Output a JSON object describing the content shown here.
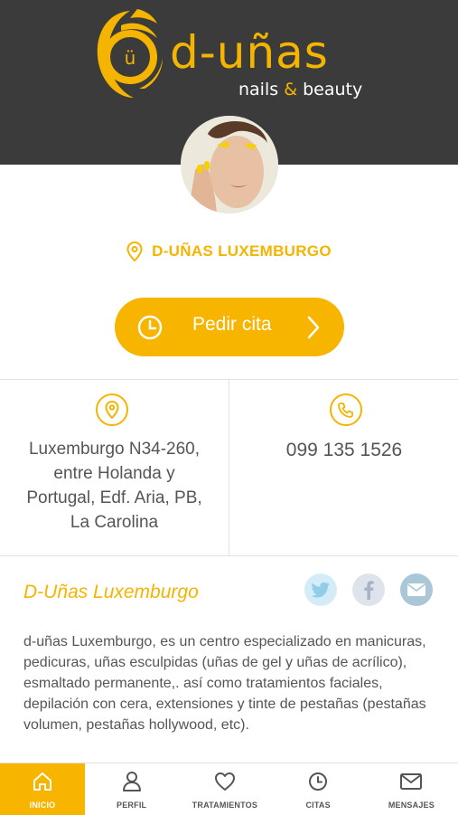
{
  "brand": {
    "name": "d-uñas",
    "tagline_left": "nails",
    "tagline_amp": "&",
    "tagline_right": "beauty",
    "logo_letter": "ü"
  },
  "colors": {
    "accent": "#f4b400",
    "header_bg": "#3b3b3b",
    "text": "#555555"
  },
  "location": {
    "name": "D-UÑAS LUXEMBURGO",
    "icon": "location-pin-icon"
  },
  "cta": {
    "label": "Pedir cita",
    "icon": "clock-icon"
  },
  "info": {
    "address_lines": [
      "Luxemburgo N34-260,",
      "entre Holanda y",
      "Portugal, Edf. Aria, PB,",
      "La Carolina"
    ],
    "phone": "099 135 1526"
  },
  "section": {
    "title": "D-Uñas Luxemburgo",
    "social": [
      "twitter-icon",
      "facebook-icon",
      "mail-icon"
    ],
    "description": "d-uñas Luxemburgo, es un centro especializado en manicuras, pedicuras, uñas esculpidas (uñas de gel y uñas de acrílico), esmaltado permanente,. así como tratamientos faciales, depilación con cera, extensiones y tinte de pestañas (pestañas volumen, pestañas hollywood, etc)."
  },
  "tabs": [
    {
      "label": "INICIO",
      "icon": "home-icon",
      "active": true
    },
    {
      "label": "PERFIL",
      "icon": "user-icon",
      "active": false
    },
    {
      "label": "TRATAMIENTOS",
      "icon": "heart-icon",
      "active": false
    },
    {
      "label": "CITAS",
      "icon": "clock-icon",
      "active": false
    },
    {
      "label": "MENSAJES",
      "icon": "envelope-icon",
      "active": false
    }
  ]
}
